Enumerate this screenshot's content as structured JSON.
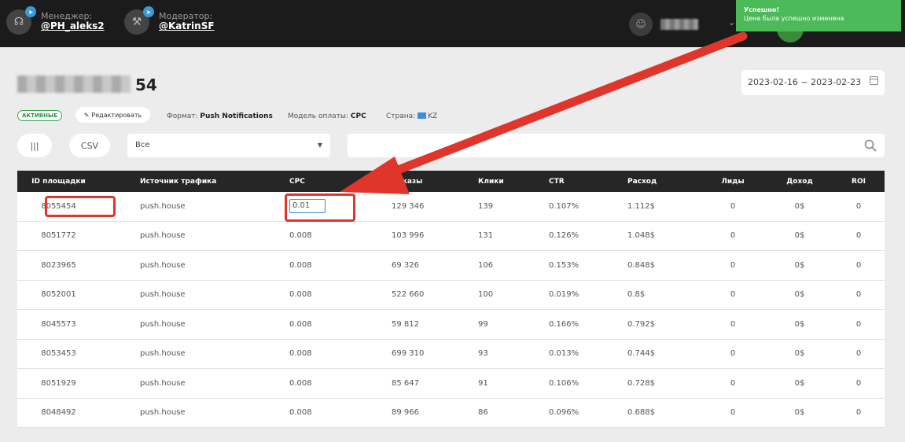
{
  "header": {
    "manager": {
      "role": "Менеджер:",
      "handle": "@PH_aleks2"
    },
    "moderator": {
      "role": "Модератор:",
      "handle": "@KatrinSF"
    }
  },
  "toast": {
    "title": "Успешно!",
    "message": "Цена была успешно изменена"
  },
  "page": {
    "title_suffix": "54"
  },
  "date_range": "2023-02-16 ~ 2023-02-23",
  "meta": {
    "status": "АКТИВНЫЕ",
    "edit_label": "Редактировать",
    "format_label": "Формат:",
    "format_value": "Push Notifications",
    "payment_label": "Модель оплаты:",
    "payment_value": "CPC",
    "country_label": "Страна:",
    "country_value": "KZ"
  },
  "controls": {
    "columns_label": "|||",
    "csv_label": "CSV",
    "filter_value": "Все"
  },
  "table": {
    "columns": [
      "ID площадки",
      "Источник трафика",
      "CPC",
      "Показы",
      "Клики",
      "CTR",
      "Расход",
      "Лиды",
      "Доход",
      "ROI"
    ],
    "rows": [
      [
        "8055454",
        "push.house",
        "0.01",
        "129 346",
        "139",
        "0.107%",
        "1.112$",
        "0",
        "0$",
        "0"
      ],
      [
        "8051772",
        "push.house",
        "0.008",
        "103 996",
        "131",
        "0.126%",
        "1.048$",
        "0",
        "0$",
        "0"
      ],
      [
        "8023965",
        "push.house",
        "0.008",
        "69 326",
        "106",
        "0.153%",
        "0.848$",
        "0",
        "0$",
        "0"
      ],
      [
        "8052001",
        "push.house",
        "0.008",
        "522 660",
        "100",
        "0.019%",
        "0.8$",
        "0",
        "0$",
        "0"
      ],
      [
        "8045573",
        "push.house",
        "0.008",
        "59 812",
        "99",
        "0.166%",
        "0.792$",
        "0",
        "0$",
        "0"
      ],
      [
        "8053453",
        "push.house",
        "0.008",
        "699 310",
        "93",
        "0.013%",
        "0.744$",
        "0",
        "0$",
        "0"
      ],
      [
        "8051929",
        "push.house",
        "0.008",
        "85 647",
        "91",
        "0.106%",
        "0.728$",
        "0",
        "0$",
        "0"
      ],
      [
        "8048492",
        "push.house",
        "0.008",
        "89 966",
        "86",
        "0.096%",
        "0.688$",
        "0",
        "0$",
        "0"
      ]
    ]
  },
  "colors": {
    "accent_blue": "#3a8fd8",
    "success_green": "#4dba5a",
    "annotation_red": "#e0352b",
    "header_dark": "#1b1b1b"
  },
  "icons": {
    "columns": "columns-icon",
    "search": "search-icon",
    "calendar": "calendar-icon",
    "edit": "pencil-icon",
    "telegram": "telegram-icon"
  }
}
